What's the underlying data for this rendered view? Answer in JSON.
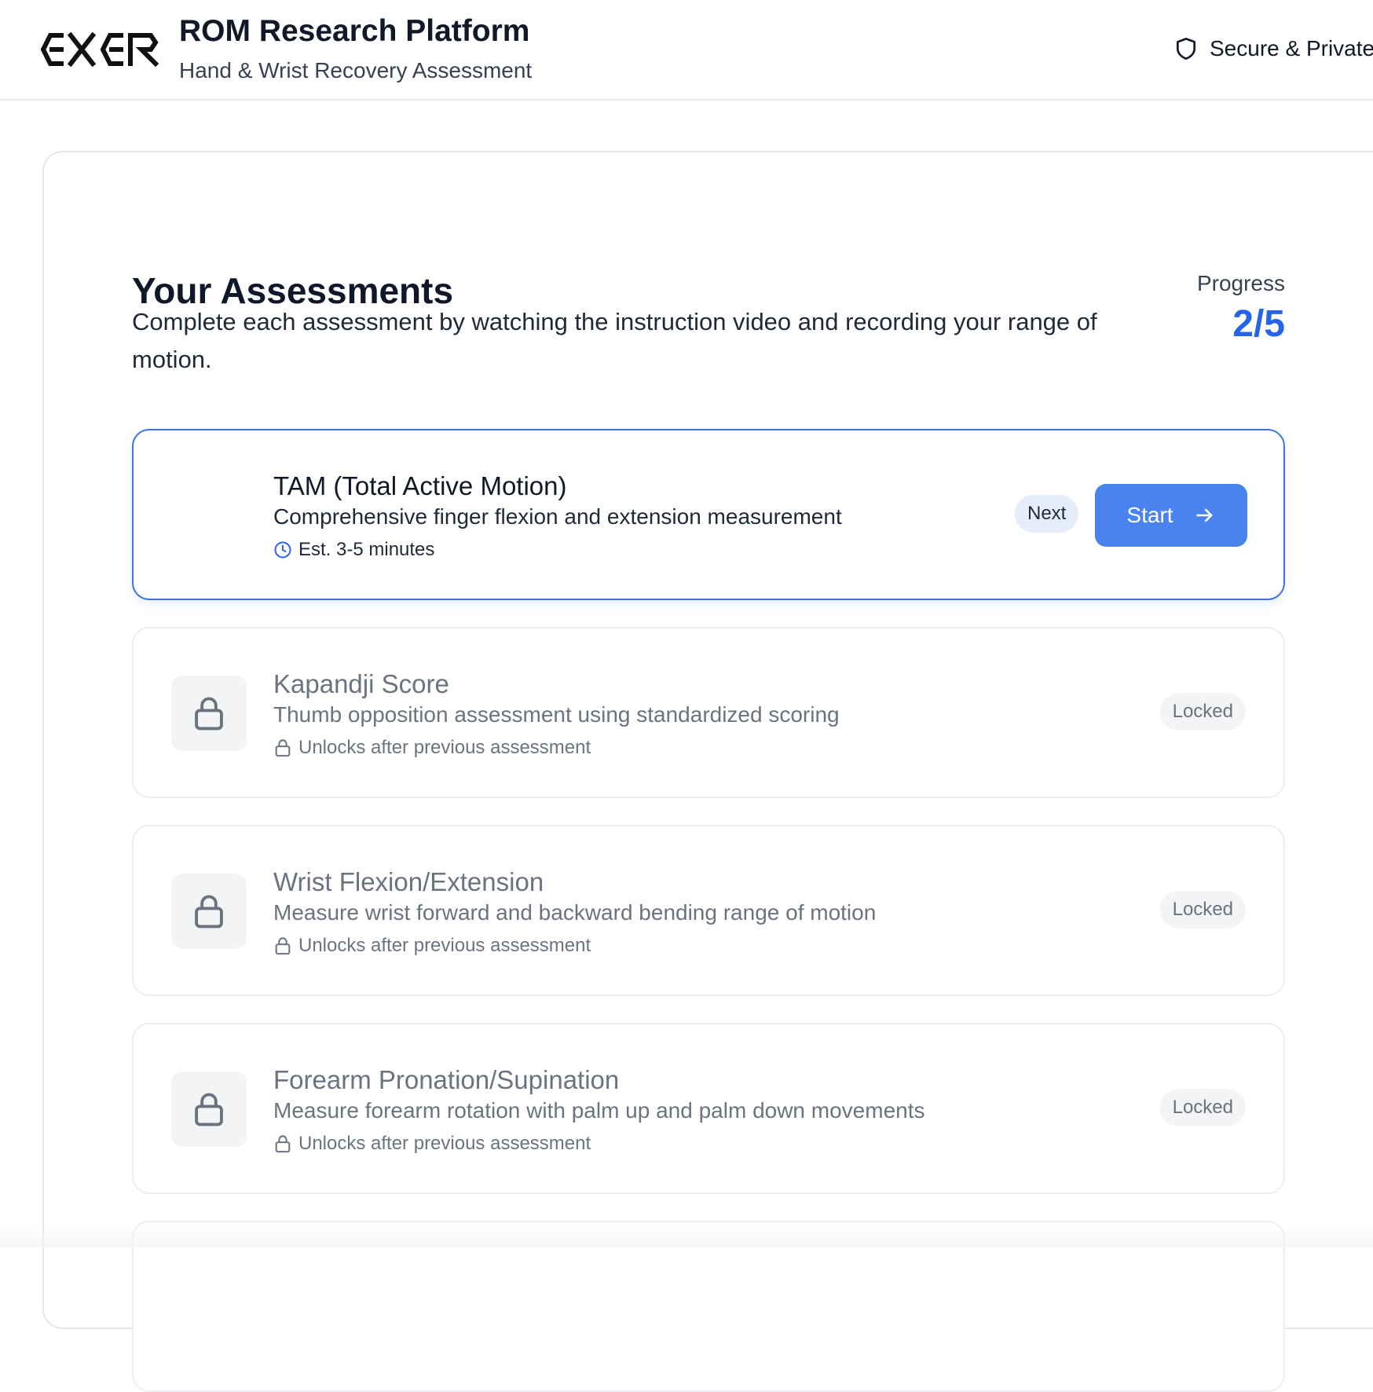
{
  "header": {
    "logo_text": "EXER",
    "title": "ROM Research Platform",
    "subtitle": "Hand & Wrist Recovery Assessment",
    "secure_label": "Secure & Private",
    "secure_icon": "shield-icon"
  },
  "main": {
    "title": "Your Assessments",
    "description": "Complete each assessment by watching the instruction video and recording your range of motion.",
    "progress_label": "Progress",
    "progress_value": "2/5",
    "progress_completed": 2,
    "progress_total": 5
  },
  "assessments": [
    {
      "title": "TAM (Total Active Motion)",
      "description": "Comprehensive finger flexion and extension measurement",
      "meta": "Est. 3-5 minutes",
      "meta_icon": "clock-icon",
      "status": "active",
      "badge": "Next",
      "action_label": "Start",
      "action_icon": "arrow-right-icon"
    },
    {
      "title": "Kapandji Score",
      "description": "Thumb opposition assessment using standardized scoring",
      "meta": "Unlocks after previous assessment",
      "meta_icon": "lock-icon",
      "status": "locked",
      "badge": "Locked"
    },
    {
      "title": "Wrist Flexion/Extension",
      "description": "Measure wrist forward and backward bending range of motion",
      "meta": "Unlocks after previous assessment",
      "meta_icon": "lock-icon",
      "status": "locked",
      "badge": "Locked"
    },
    {
      "title": "Forearm Pronation/Supination",
      "description": "Measure forearm rotation with palm up and palm down movements",
      "meta": "Unlocks after previous assessment",
      "meta_icon": "lock-icon",
      "status": "locked",
      "badge": "Locked"
    }
  ],
  "colors": {
    "accent": "#2563eb",
    "button": "#4b83ee",
    "active_border": "#3b74e6",
    "locked_text": "#6b7280",
    "locked_bg": "#f3f4f6"
  }
}
